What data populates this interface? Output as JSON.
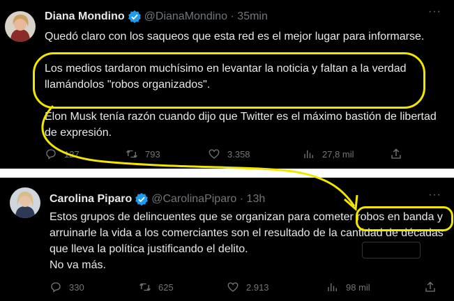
{
  "tweets": [
    {
      "author": "Diana Mondino",
      "handle": "@DianaMondino",
      "time": "35min",
      "paragraphs": [
        "Quedó claro con los saqueos que esta red es el mejor lugar para informarse.",
        "Los medios tardaron muchísimo en levantar la noticia y faltan a la verdad llamándolos \"robos organizados\".",
        "Elon Musk tenía razón cuando dijo que Twitter es el máximo bastión de libertad de expresión."
      ],
      "stats": {
        "replies": "127",
        "retweets": "793",
        "likes": "3.358",
        "views": "27,8 mil"
      }
    },
    {
      "author": "Carolina Piparo",
      "handle": "@CarolinaPiparo",
      "time": "13h",
      "paragraphs": [
        "Estos grupos de delincuentes que se organizan para cometer robos en banda y arruinarle la vida a los comerciantes son el resultado de la cantidad de décadas que lleva la política justificando el delito.",
        "No va más."
      ],
      "stats": {
        "replies": "330",
        "retweets": "625",
        "likes": "2.913",
        "views": "98 mil"
      }
    }
  ],
  "colors": {
    "background": "#000000",
    "text": "#e7e9ea",
    "muted": "#71767b",
    "verified": "#1d9bf0",
    "annotation": "#f2e600"
  },
  "icons": [
    "verified-badge-icon",
    "more-icon",
    "reply-icon",
    "retweet-icon",
    "like-icon",
    "views-icon",
    "share-icon"
  ]
}
